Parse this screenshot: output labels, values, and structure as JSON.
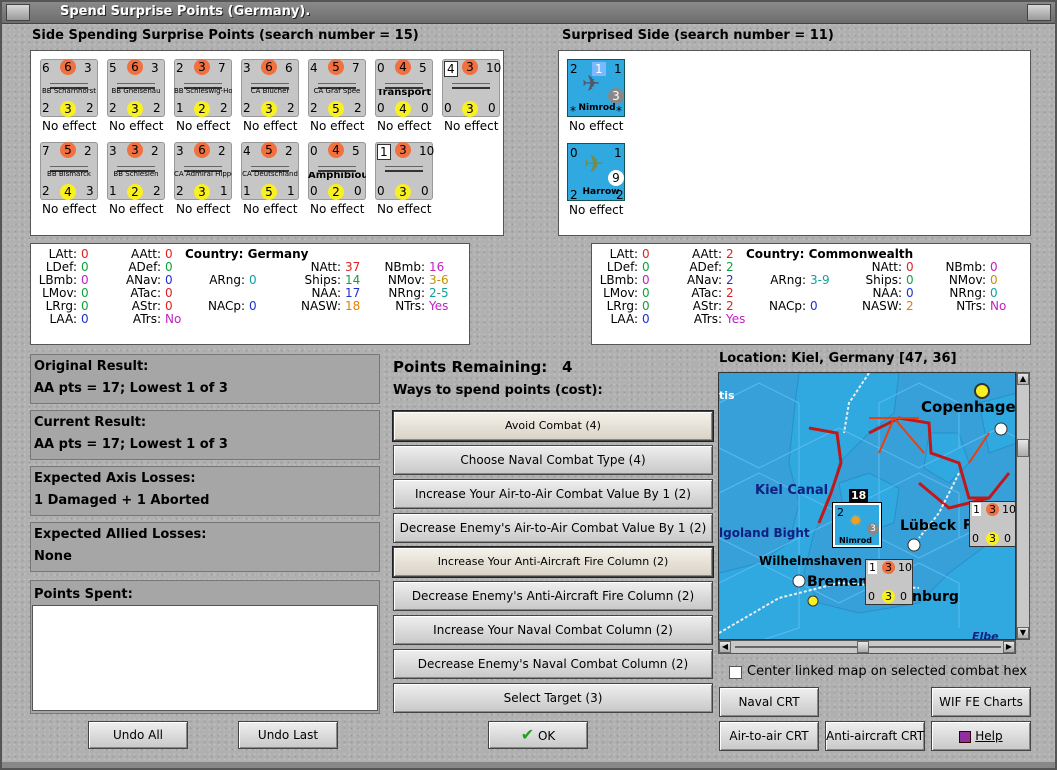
{
  "window": {
    "title": "Spend Surprise Points (Germany)."
  },
  "left": {
    "header": "Side Spending Surprise Points (search number = 15)",
    "row1": [
      {
        "tl": "6",
        "top": "6",
        "tr": "3",
        "name": "BB Scharnhorst",
        "bl": "2",
        "bot": "3",
        "br": "2",
        "effect": "No effect"
      },
      {
        "tl": "5",
        "top": "6",
        "tr": "3",
        "name": "BB Gneisenau",
        "bl": "2",
        "bot": "3",
        "br": "2",
        "effect": "No effect"
      },
      {
        "tl": "2",
        "top": "3",
        "tr": "7",
        "name": "BB Schleswig-Holstein",
        "bl": "1",
        "bot": "2",
        "br": "2",
        "effect": "No effect"
      },
      {
        "tl": "3",
        "top": "6",
        "tr": "6",
        "name": "CA Blücher",
        "bl": "2",
        "bot": "3",
        "br": "2",
        "effect": "No effect"
      },
      {
        "tl": "4",
        "top": "5",
        "tr": "7",
        "name": "CA Graf Spee",
        "bl": "2",
        "bot": "5",
        "br": "2",
        "effect": "No effect"
      },
      {
        "tl": "0",
        "top": "4",
        "tr": "5",
        "name": "Transport",
        "bl": "0",
        "bot": "4",
        "br": "0",
        "effect": "No effect"
      },
      {
        "tl": "4",
        "top": "3",
        "tr": "10",
        "name": "",
        "bl": "0",
        "bot": "3",
        "br": "0",
        "effect": "No effect"
      }
    ],
    "row2": [
      {
        "tl": "7",
        "top": "5",
        "tr": "2",
        "name": "BB Bismarck",
        "bl": "2",
        "bot": "4",
        "br": "3",
        "effect": "No effect"
      },
      {
        "tl": "3",
        "top": "3",
        "tr": "2",
        "name": "BB Schlesien",
        "bl": "1",
        "bot": "2",
        "br": "2",
        "effect": "No effect"
      },
      {
        "tl": "3",
        "top": "6",
        "tr": "2",
        "name": "CA Admiral Hipper",
        "bl": "2",
        "bot": "3",
        "br": "1",
        "effect": "No effect"
      },
      {
        "tl": "4",
        "top": "5",
        "tr": "2",
        "name": "CA Deutschland",
        "bl": "1",
        "bot": "5",
        "br": "1",
        "effect": "No effect"
      },
      {
        "tl": "0",
        "top": "4",
        "tr": "5",
        "name": "Amphibious",
        "bl": "0",
        "bot": "2",
        "br": "0",
        "effect": "No effect"
      },
      {
        "tl": "1",
        "top": "3",
        "tr": "10",
        "name": "",
        "bl": "0",
        "bot": "3",
        "br": "0",
        "effect": "No effect"
      }
    ]
  },
  "right": {
    "header": "Surprised Side (search number = 11)",
    "units": [
      {
        "tl": "2",
        "top": "1",
        "tr": "1",
        "name": "Nimrod",
        "bl": "*",
        "br": "*",
        "circle": "3",
        "effect": "No effect"
      },
      {
        "tl": "0",
        "tr": "1",
        "name": "Harrow",
        "bl": "2",
        "br": "2",
        "circle": "9",
        "effect": "No effect"
      }
    ]
  },
  "axis_stats": {
    "country_label": "Country: Germany",
    "LAtt": "0",
    "LDef": "0",
    "LBmb": "0",
    "LMov": "0",
    "LRrg": "0",
    "LAA": "0",
    "AAtt": "0",
    "ADef": "0",
    "ANav": "0",
    "ATac": "0",
    "AStr": "0",
    "ATrs": "No",
    "ARng": "0",
    "NACp": "0",
    "NAtt": "37",
    "Ships": "14",
    "NAA": "17",
    "NASW": "18",
    "NBmb": "16",
    "NMov": "3-6",
    "NRng": "2-5",
    "NTrs": "Yes"
  },
  "allied_stats": {
    "country_label": "Country: Commonwealth",
    "LAtt": "0",
    "LDef": "0",
    "LBmb": "0",
    "LMov": "0",
    "LRrg": "0",
    "LAA": "0",
    "AAtt": "2",
    "ADef": "2",
    "ANav": "2",
    "ATac": "2",
    "AStr": "2",
    "ATrs": "Yes",
    "ARng": "3-9",
    "NACp": "0",
    "NAtt": "0",
    "Ships": "0",
    "NAA": "0",
    "NASW": "2",
    "NBmb": "0",
    "NMov": "0",
    "NRng": "0",
    "NTrs": "No"
  },
  "results": {
    "original_label": "Original Result:",
    "original_value": "AA pts = 17; Lowest 1 of 3",
    "current_label": "Current Result:",
    "current_value": "AA pts = 17; Lowest 1 of 3",
    "axis_losses_label": "Expected Axis Losses:",
    "axis_losses_value": "1 Damaged + 1 Aborted",
    "allied_losses_label": "Expected Allied Losses:",
    "allied_losses_value": "None",
    "points_spent_label": "Points Spent:"
  },
  "points": {
    "remaining_label": "Points Remaining:",
    "remaining_value": "4",
    "ways_label": "Ways to spend points (cost):"
  },
  "options": [
    "Avoid Combat (4)",
    "Choose Naval Combat Type (4)",
    "Increase Your Air-to-Air Combat Value By 1 (2)",
    "Decrease Enemy's Air-to-Air Combat Value By 1 (2)",
    "Increase Your Anti-Aircraft Fire Column (2)",
    "Decrease Enemy's Anti-Aircraft Fire Column (2)",
    "Increase Your Naval Combat Column (2)",
    "Decrease Enemy's Naval Combat Column (2)",
    "Select Target (3)"
  ],
  "buttons": {
    "undo_all": "Undo All",
    "undo_last": "Undo Last",
    "ok": "OK",
    "naval_crt": "Naval CRT",
    "wif_charts": "WIF FE Charts",
    "air_crt": "Air-to-air CRT",
    "aa_crt": "Anti-aircraft CRT",
    "help": "Help"
  },
  "map": {
    "location": "Location: Kiel, Germany [47, 36]",
    "labels": {
      "copenhagen": "Copenhagen",
      "kiel": "Kiel Canal",
      "bight": "lgoland Bight",
      "lubeck": "Lübeck",
      "wilhelm": "Wilhelmshaven",
      "bremen": "Bremen",
      "hamburg": "nburg",
      "elbe": "Elbe",
      "tis": "tis",
      "p": "P",
      "stack": "18"
    },
    "counter_a": {
      "tl": "2",
      "name": "Nimrod",
      "circle": "3"
    },
    "counter_b": {
      "tl": "1",
      "top": "3",
      "tr": "10",
      "bl": "0",
      "bot": "3",
      "br": "0"
    },
    "counter_c": {
      "tl": "1",
      "top": "3",
      "tr": "10",
      "bl": "0",
      "bot": "3",
      "br": "0"
    }
  },
  "center_map_label": "Center linked map on selected combat hex",
  "colors": {
    "sea": "#38a0d8",
    "land": "#30a8e0",
    "border_red": "#c01818"
  }
}
